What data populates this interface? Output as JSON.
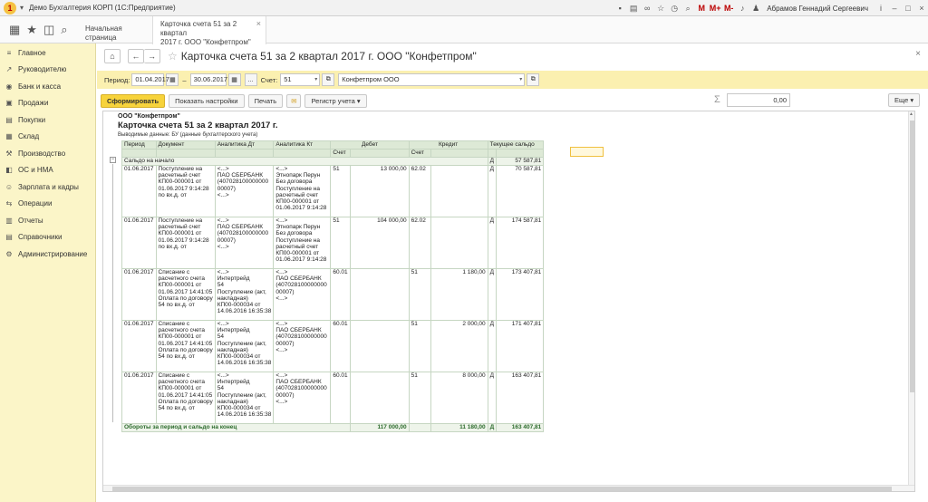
{
  "window": {
    "title": "Демо Бухгалтерия КОРП  (1С:Предприятие)",
    "user": "Абрамов Геннадий Сергеевич",
    "tb_icons": [
      "save-icon",
      "print-icon",
      "link-icon",
      "favorite-icon",
      "history-icon",
      "search-icon",
      "memory-icon",
      "zoom-in-icon",
      "zoom-out-icon",
      "info-icon",
      "minimize-icon",
      "maximize-icon",
      "close-icon"
    ],
    "memory_labels": [
      "M",
      "M+",
      "M-"
    ],
    "info": "i",
    "min": "–",
    "max": "□",
    "close": "×"
  },
  "tabs": {
    "home": "Начальная страница",
    "active_line1": "Карточка счета 51 за 2 квартал",
    "active_line2": "2017 г. ООО \"Конфетпром\"",
    "active_close": "×"
  },
  "top_icons": {
    "grid": "▦",
    "star": "★",
    "history": "◫",
    "search": "⌕"
  },
  "sidebar": {
    "items": [
      {
        "label": "Главное",
        "icon": "≡"
      },
      {
        "label": "Руководителю",
        "icon": "↗"
      },
      {
        "label": "Банк и касса",
        "icon": "◉"
      },
      {
        "label": "Продажи",
        "icon": "▣"
      },
      {
        "label": "Покупки",
        "icon": "▤"
      },
      {
        "label": "Склад",
        "icon": "▦"
      },
      {
        "label": "Производство",
        "icon": "⚒"
      },
      {
        "label": "ОС и НМА",
        "icon": "◧"
      },
      {
        "label": "Зарплата и кадры",
        "icon": "☺"
      },
      {
        "label": "Операции",
        "icon": "⇆"
      },
      {
        "label": "Отчеты",
        "icon": "▥"
      },
      {
        "label": "Справочники",
        "icon": "▤"
      },
      {
        "label": "Администрирование",
        "icon": "⚙"
      }
    ]
  },
  "header": {
    "title": "Карточка счета 51 за 2 квартал 2017 г. ООО \"Конфетпром\"",
    "home": "⌂",
    "back": "←",
    "fwd": "→",
    "star": "☆",
    "more": "⋮",
    "close": "×"
  },
  "filters": {
    "period_label": "Период:",
    "date_from": "01.04.2017",
    "dash": "–",
    "date_to": "30.06.2017",
    "pick": "...",
    "account_label": "Счет:",
    "account": "51",
    "org": "Конфетпром ООО",
    "dd": "▾",
    "clear": "×",
    "open": "⧉"
  },
  "toolbar": {
    "generate": "Сформировать",
    "settings": "Показать настройки",
    "print": "Печать",
    "register": "Регистр учета ▾",
    "sigma": "Σ",
    "sum": "0,00",
    "more": "Еще ▾"
  },
  "report": {
    "org": "ООО \"Конфетпром\"",
    "title": "Карточка счета 51 за 2 квартал 2017 г.",
    "output": "Выводимые данные:  БУ (данные бухгалтерского учета)",
    "head": {
      "period": "Период",
      "doc": "Документ",
      "an_dt": "Аналитика Дт",
      "an_kt": "Аналитика Кт",
      "debit": "Дебет",
      "credit": "Кредит",
      "balance": "Текущее сальдо",
      "acct": "Счет"
    },
    "start": {
      "label": "Сальдо на начало",
      "dk": "Д",
      "sum": "57 587,81"
    },
    "rows": [
      {
        "date": "01.06.2017",
        "doc": [
          "Поступление на",
          "расчетный счет",
          "КП00-000001 от",
          "01.06.2017 9:14:28",
          "  по вх.д.  от"
        ],
        "an_dt": [
          "<...>",
          "ПАО СБЕРБАНК",
          "(407028100000000",
          "00007)",
          "<...>"
        ],
        "an_kt": [
          "<...>",
          "Этнопарк Перун",
          "Без договора",
          "Поступление на",
          "расчетный счет",
          "КП00-000001 от",
          "01.06.2017 9:14:28"
        ],
        "dt_acct": "51",
        "dt_sum": "13 000,00",
        "kt_acct": "62.02",
        "kt_sum": "",
        "dk": "Д",
        "bal": "70 587,81"
      },
      {
        "date": "01.06.2017",
        "doc": [
          "Поступление на",
          "расчетный счет",
          "КП00-000001 от",
          "01.06.2017 9:14:28",
          "  по вх.д.  от"
        ],
        "an_dt": [
          "<...>",
          "ПАО СБЕРБАНК",
          "(407028100000000",
          "00007)",
          "<...>"
        ],
        "an_kt": [
          "<...>",
          "Этнопарк Перун",
          "Без договора",
          "Поступление на",
          "расчетный счет",
          "КП00-000001 от",
          "01.06.2017 9:14:28"
        ],
        "dt_acct": "51",
        "dt_sum": "104 000,00",
        "kt_acct": "62.02",
        "kt_sum": "",
        "dk": "Д",
        "bal": "174 587,81"
      },
      {
        "date": "01.06.2017",
        "doc": [
          "Списание с",
          "расчетного счета",
          "КП00-000001 от",
          "01.06.2017 14:41:05",
          "Оплата по договору",
          "54 по вх.д.  от"
        ],
        "an_dt": [
          "<...>",
          "Интертрейд",
          "54",
          "Поступление (акт,",
          "накладная)",
          "КП00-000034 от",
          "14.06.2016 16:35:38"
        ],
        "an_kt": [
          "<...>",
          "ПАО СБЕРБАНК",
          "(407028100000000",
          "00007)",
          "<...>"
        ],
        "dt_acct": "60.01",
        "dt_sum": "",
        "kt_acct": "51",
        "kt_sum": "1 180,00",
        "dk": "Д",
        "bal": "173 407,81"
      },
      {
        "date": "01.06.2017",
        "doc": [
          "Списание с",
          "расчетного счета",
          "КП00-000001 от",
          "01.06.2017 14:41:05",
          "Оплата по договору",
          "54 по вх.д.  от"
        ],
        "an_dt": [
          "<...>",
          "Интертрейд",
          "54",
          "Поступление (акт,",
          "накладная)",
          "КП00-000034 от",
          "14.06.2016 16:35:38"
        ],
        "an_kt": [
          "<...>",
          "ПАО СБЕРБАНК",
          "(407028100000000",
          "00007)",
          "<...>"
        ],
        "dt_acct": "60.01",
        "dt_sum": "",
        "kt_acct": "51",
        "kt_sum": "2 000,00",
        "dk": "Д",
        "bal": "171 407,81"
      },
      {
        "date": "01.06.2017",
        "doc": [
          "Списание с",
          "расчетного счета",
          "КП00-000001 от",
          "01.06.2017 14:41:05",
          "Оплата по договору",
          "54 по вх.д.  от"
        ],
        "an_dt": [
          "<...>",
          "Интертрейд",
          "54",
          "Поступление (акт,",
          "накладная)",
          "КП00-000034 от",
          "14.06.2016 16:35:38"
        ],
        "an_kt": [
          "<...>",
          "ПАО СБЕРБАНК",
          "(407028100000000",
          "00007)",
          "<...>"
        ],
        "dt_acct": "60.01",
        "dt_sum": "",
        "kt_acct": "51",
        "kt_sum": "8 000,00",
        "dk": "Д",
        "bal": "163 407,81"
      }
    ],
    "total": {
      "label": "Обороты за период и сальдо на конец",
      "debit": "117 000,00",
      "credit": "11 180,00",
      "dk": "Д",
      "bal": "163 407,81"
    }
  },
  "colors": {
    "accent": "#f7d33b",
    "sidebar": "#fbf5c8",
    "filterbar": "#fbf0b0",
    "table_head": "#dde9d6",
    "total_text": "#2c6b2c"
  }
}
